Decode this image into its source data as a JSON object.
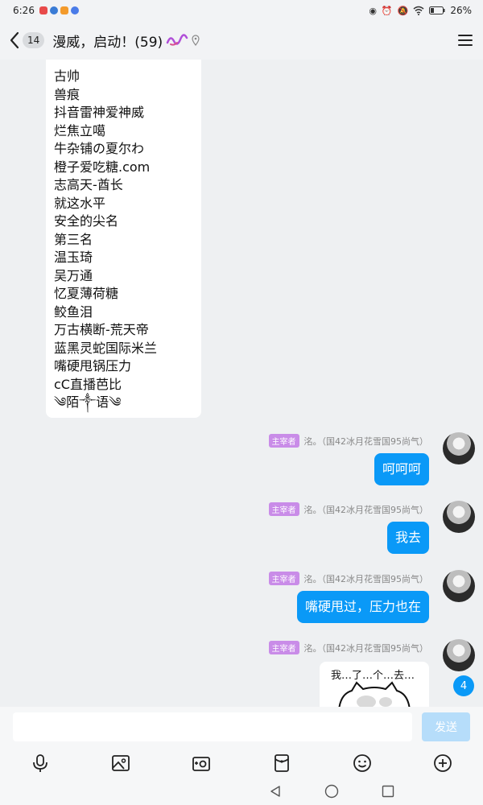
{
  "status": {
    "time": "6:26",
    "battery": "26%"
  },
  "header": {
    "unread": "14",
    "title": "漫威，启动！(59)"
  },
  "list_message": {
    "lines": [
      "古帅",
      "兽痕",
      "抖音雷神爱神威",
      "烂焦立噶",
      "牛杂铺の夏尔わ",
      "橙子爱吃糖.com",
      "志高天-酋长",
      "就这水平",
      "安全的尖名",
      "第三名",
      "温玉琦",
      "吴万通",
      "忆夏薄荷糖",
      "鲛鱼泪",
      "万古横断-荒天帝",
      "蓝黑灵蛇国际米兰",
      "嘴硬甩锅压力",
      "cC直播芭比",
      "༄陌༒语༄"
    ]
  },
  "messages": [
    {
      "role": "主宰者",
      "sender": "洺。（国42冰月花雪国95尚气）",
      "text": "呵呵呵"
    },
    {
      "role": "主宰者",
      "sender": "洺。（国42冰月花雪国95尚气）",
      "text": "我去"
    },
    {
      "role": "主宰者",
      "sender": "洺。（国42冰月花雪国95尚气）",
      "text": "嘴硬甩过，压力也在"
    },
    {
      "role": "主宰者",
      "sender": "洺。（国42冰月花雪国95尚气）",
      "sticker_text": "我…了…个…去…"
    }
  ],
  "unread_float": "4",
  "input": {
    "value": "",
    "placeholder": "",
    "send_label": "发送"
  },
  "toolbar_icons": [
    "microphone-icon",
    "image-icon",
    "camera-icon",
    "red-packet-icon",
    "emoji-icon",
    "plus-icon"
  ],
  "colors": {
    "accent": "#0a99f7",
    "role_badge": "#c98ce8",
    "send_disabled": "#b6ddfa"
  }
}
